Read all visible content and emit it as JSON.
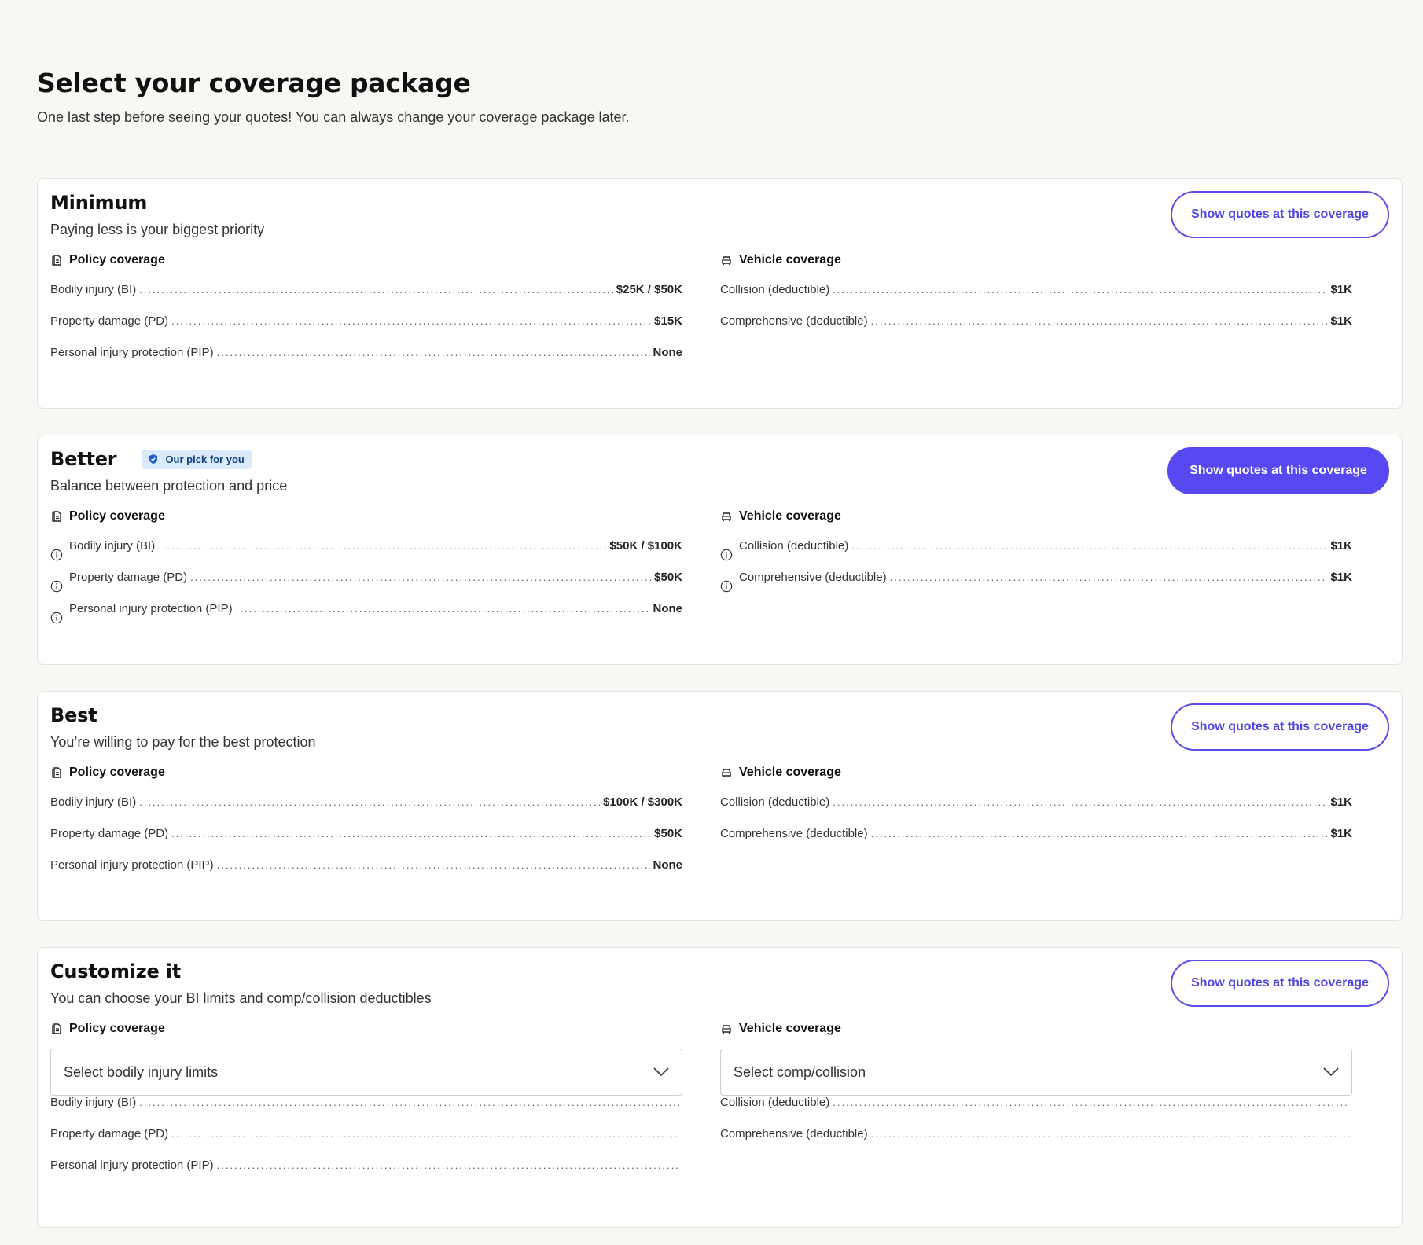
{
  "page": {
    "title": "Select your coverage package",
    "subtitle": "One last step before seeing your quotes! You can always change your coverage package later."
  },
  "colors": {
    "accent": "#5649f2",
    "badge_bg": "#d9ebfb",
    "badge_text": "#14408a",
    "page_bg": "#f8f7f4"
  },
  "packages": [
    {
      "title": "Minimum",
      "subtitle": "Paying less is your biggest priority",
      "cta_label": "Show quotes at this coverage",
      "policy_heading": "Policy coverage",
      "vehicle_heading": "Vehicle coverage",
      "policy": [
        {
          "label": "Bodily injury (BI)",
          "value": "$25K / $50K"
        },
        {
          "label": "Property damage (PD)",
          "value": "$15K"
        },
        {
          "label": "Personal injury protection (PIP)",
          "value": "None"
        }
      ],
      "vehicle": [
        {
          "label": "Collision (deductible)",
          "value": "$1K"
        },
        {
          "label": "Comprehensive (deductible)",
          "value": "$1K"
        }
      ]
    },
    {
      "title": "Better",
      "badge": "Our pick for you",
      "subtitle": "Balance between protection and price",
      "cta_label": "Show quotes at this coverage",
      "policy_heading": "Policy coverage",
      "vehicle_heading": "Vehicle coverage",
      "policy": [
        {
          "label": "Bodily injury (BI)",
          "value": "$50K / $100K"
        },
        {
          "label": "Property damage (PD)",
          "value": "$50K"
        },
        {
          "label": "Personal injury protection (PIP)",
          "value": "None"
        }
      ],
      "vehicle": [
        {
          "label": "Collision (deductible)",
          "value": "$1K"
        },
        {
          "label": "Comprehensive (deductible)",
          "value": "$1K"
        }
      ]
    },
    {
      "title": "Best",
      "subtitle": "You’re willing to pay for the best protection",
      "cta_label": "Show quotes at this coverage",
      "policy_heading": "Policy coverage",
      "vehicle_heading": "Vehicle coverage",
      "policy": [
        {
          "label": "Bodily injury (BI)",
          "value": "$100K / $300K"
        },
        {
          "label": "Property damage (PD)",
          "value": "$50K"
        },
        {
          "label": "Personal injury protection (PIP)",
          "value": "None"
        }
      ],
      "vehicle": [
        {
          "label": "Collision (deductible)",
          "value": "$1K"
        },
        {
          "label": "Comprehensive (deductible)",
          "value": "$1K"
        }
      ]
    },
    {
      "title": "Customize it",
      "subtitle": "You can choose your BI limits and comp/collision deductibles",
      "cta_label": "Show quotes at this coverage",
      "policy_heading": "Policy coverage",
      "vehicle_heading": "Vehicle coverage",
      "policy_select": "Select bodily injury limits",
      "vehicle_select": "Select comp/collision",
      "policy": [
        {
          "label": "Bodily injury (BI)",
          "value": ""
        },
        {
          "label": "Property damage (PD)",
          "value": ""
        },
        {
          "label": "Personal injury protection (PIP)",
          "value": ""
        }
      ],
      "vehicle": [
        {
          "label": "Collision (deductible)",
          "value": ""
        },
        {
          "label": "Comprehensive (deductible)",
          "value": ""
        }
      ]
    }
  ],
  "icons": {
    "policy": "document-icon",
    "vehicle": "car-icon",
    "info": "info-icon",
    "badge": "shield-check-icon",
    "select": "chevron-down-icon"
  }
}
